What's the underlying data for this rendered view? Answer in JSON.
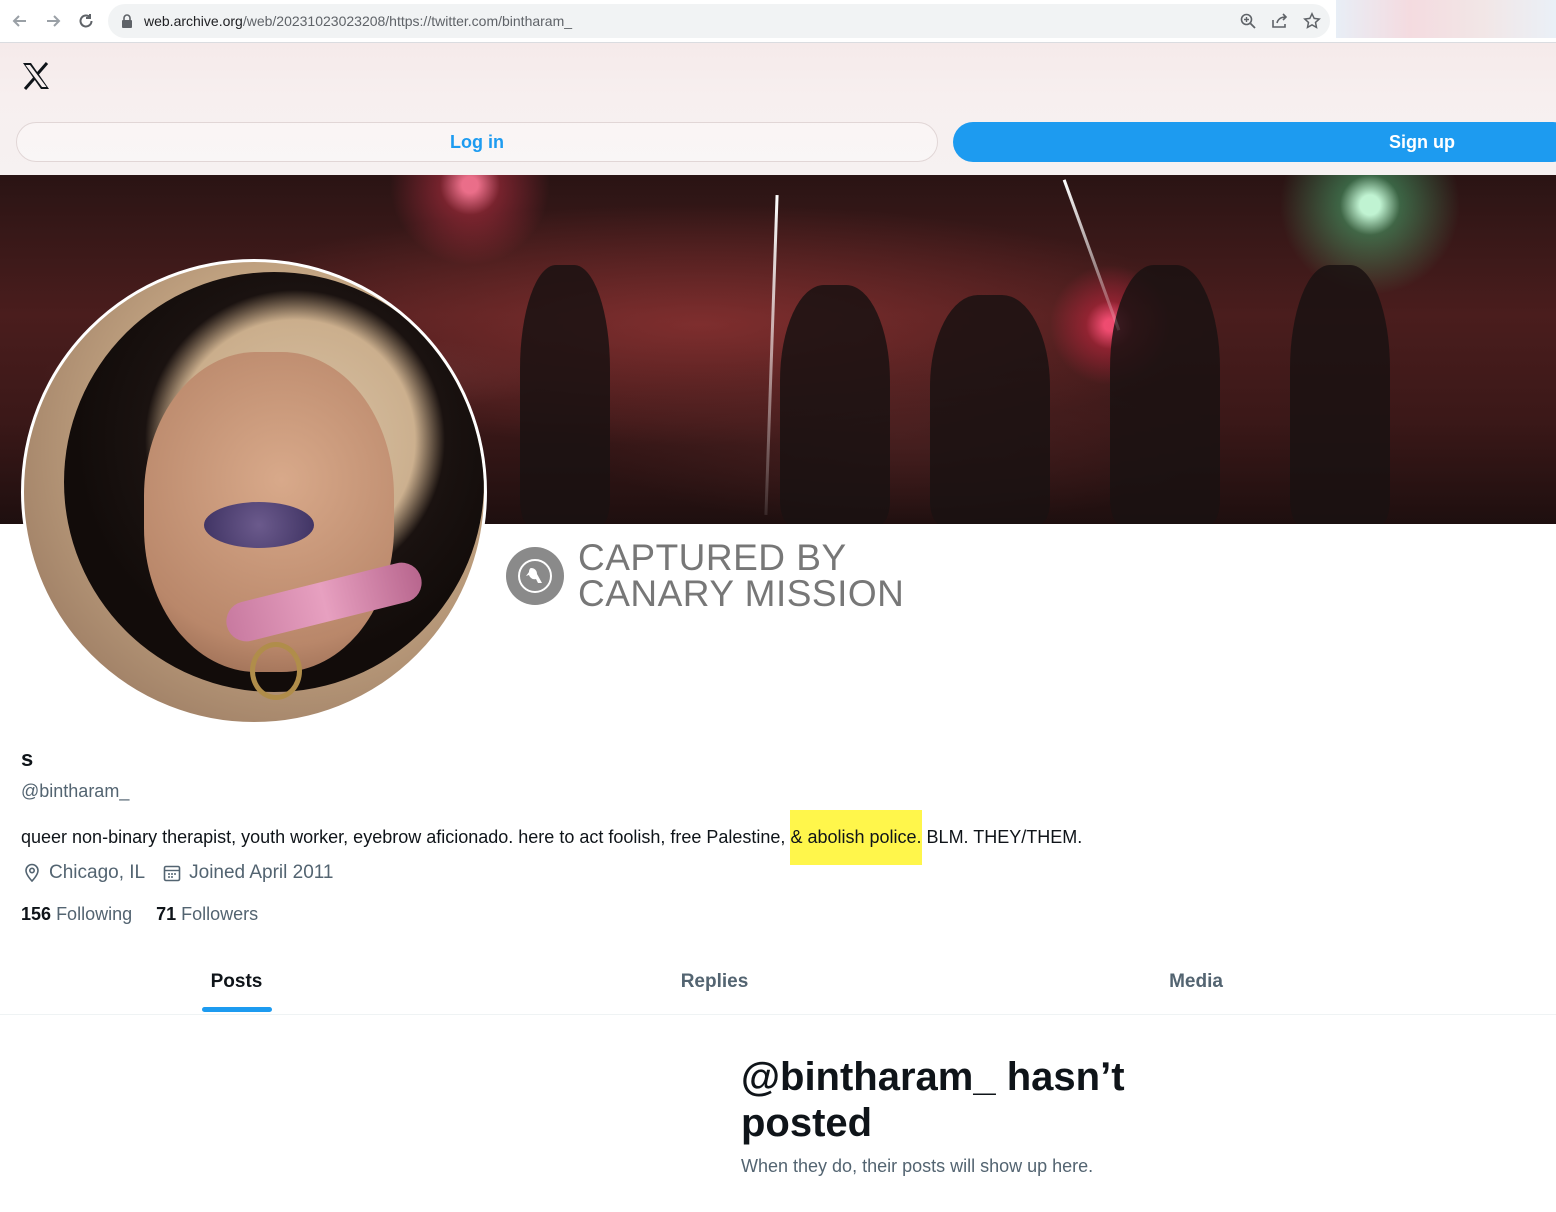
{
  "browser": {
    "url_host": "web.archive.org",
    "url_path": "/web/20231023023208/https://twitter.com/bintharam_"
  },
  "header": {
    "login_label": "Log in",
    "signup_label": "Sign up"
  },
  "watermark": {
    "line1": "CAPTURED BY",
    "line2": "CANARY MISSION"
  },
  "profile": {
    "name": "s",
    "handle": "@bintharam_",
    "bio_before": "queer non-binary therapist, youth worker, eyebrow aficionado. here to act foolish, free Palestine, ",
    "bio_highlight": "& abolish police.",
    "bio_after": " BLM. THEY/THEM.",
    "highlight_color": "#fff64b",
    "location": "Chicago, IL",
    "joined": "Joined April 2011",
    "following_count": "156",
    "following_label": "Following",
    "followers_count": "71",
    "followers_label": "Followers"
  },
  "tabs": [
    {
      "label": "Posts",
      "active": true
    },
    {
      "label": "Replies",
      "active": false
    },
    {
      "label": "Media",
      "active": false
    }
  ],
  "empty_state": {
    "title": "@bintharam_ hasn’t posted",
    "subtitle": "When they do, their posts will show up here."
  },
  "colors": {
    "accent": "#1d9bf0",
    "text_secondary": "#536471"
  }
}
